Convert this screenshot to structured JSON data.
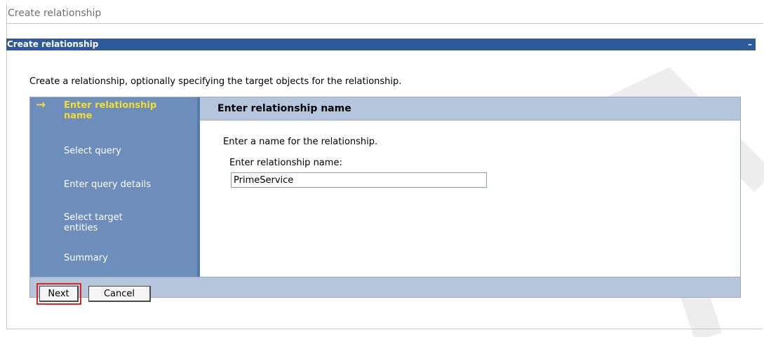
{
  "page": {
    "title": "Create relationship"
  },
  "portlet": {
    "title": "Create relationship",
    "minimize_icon": "minimize-icon"
  },
  "intro_text": "Create a relationship, optionally specifying the target objects for the relationship.",
  "wizard": {
    "steps": [
      {
        "label": "Enter relationship name",
        "current": true
      },
      {
        "label": "Select query",
        "current": false
      },
      {
        "label": "Enter query details",
        "current": false
      },
      {
        "label": "Select target entities",
        "current": false
      },
      {
        "label": "Summary",
        "current": false
      }
    ],
    "current_step_icon": "arrow-right-icon",
    "content": {
      "header": "Enter relationship name",
      "description": "Enter a name for the relationship.",
      "field_label": "Enter relationship name:",
      "field_value": "PrimeService"
    }
  },
  "buttons": {
    "next": "Next",
    "cancel": "Cancel"
  },
  "colors": {
    "portlet_header": "#2d5a9a",
    "step_panel": "#6d8dbb",
    "current_step": "#f3dd2c",
    "content_header": "#b5c5dc",
    "highlight": "#e02424"
  }
}
